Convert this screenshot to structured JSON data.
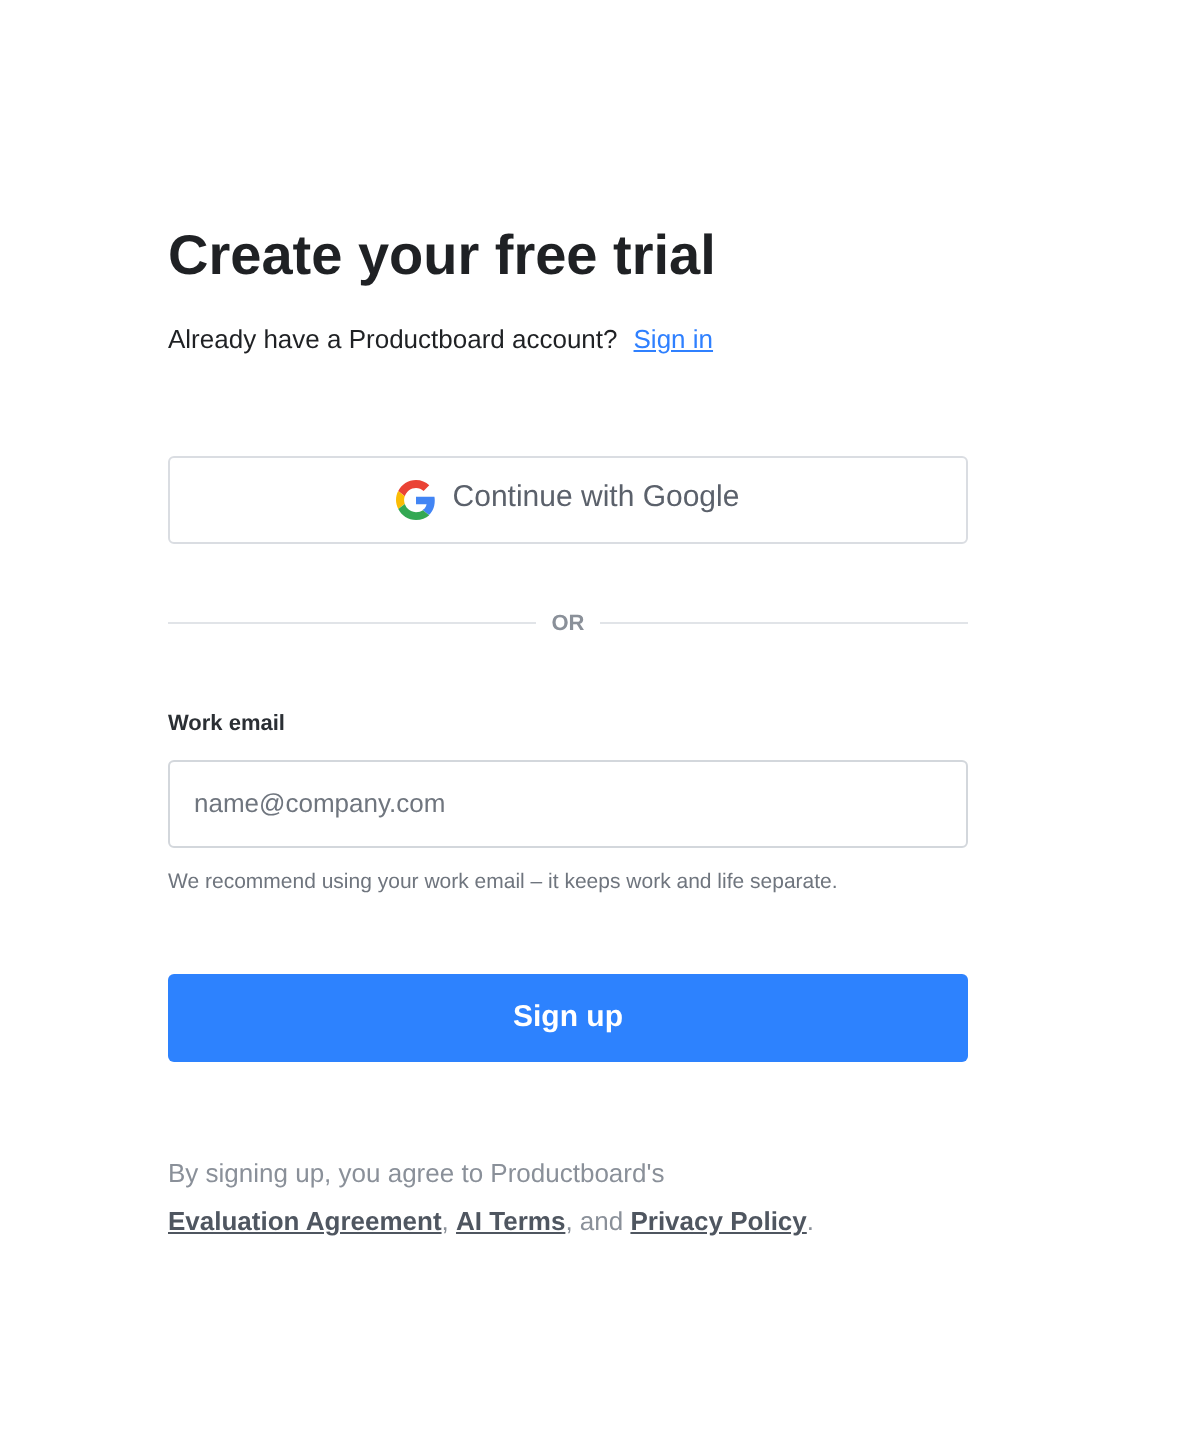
{
  "title": "Create your free trial",
  "signin_prompt": {
    "text": "Already have a Productboard account?",
    "link": "Sign in"
  },
  "google_button": "Continue with Google",
  "divider": "OR",
  "email": {
    "label": "Work email",
    "placeholder": "name@company.com",
    "hint": "We recommend using your work email – it keeps work and life separate."
  },
  "submit": "Sign up",
  "legal": {
    "prefix": "By signing up, you agree to Productboard's",
    "parts": [
      {
        "kind": "link",
        "text": "Evaluation Agreement"
      },
      {
        "kind": "text",
        "text": ", "
      },
      {
        "kind": "link",
        "text": "AI Terms"
      },
      {
        "kind": "text",
        "text": ", and "
      },
      {
        "kind": "link",
        "text": "Privacy Policy"
      },
      {
        "kind": "text",
        "text": "."
      }
    ]
  }
}
